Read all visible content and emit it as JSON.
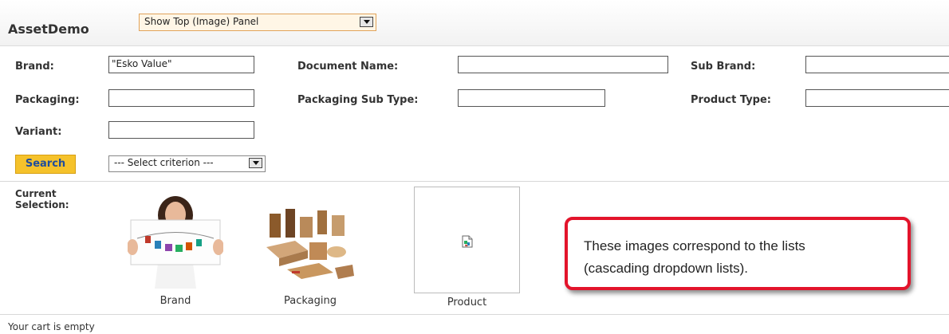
{
  "header": {
    "app_title": "AssetDemo",
    "panel_select_value": "Show Top (Image) Panel"
  },
  "filters": {
    "brand": {
      "label": "Brand:",
      "value": "\"Esko Value\""
    },
    "document_name": {
      "label": "Document Name:",
      "value": ""
    },
    "sub_brand": {
      "label": "Sub Brand:",
      "value": ""
    },
    "packaging": {
      "label": "Packaging:",
      "value": ""
    },
    "packaging_sub_type": {
      "label": "Packaging Sub Type:",
      "value": ""
    },
    "product_type": {
      "label": "Product Type:",
      "value": ""
    },
    "variant": {
      "label": "Variant:",
      "value": ""
    }
  },
  "search": {
    "button_label": "Search",
    "criterion_select_value": "--- Select criterion ---"
  },
  "selection": {
    "heading_line1": "Current",
    "heading_line2": "Selection:",
    "thumbnails": [
      {
        "label": "Brand",
        "icon": "woman-holding-photo-strip"
      },
      {
        "label": "Packaging",
        "icon": "packaging-boxes"
      },
      {
        "label": "Product",
        "icon": "broken-image-icon"
      }
    ]
  },
  "callout": {
    "line1": "These images correspond to the lists",
    "line2": "(cascading dropdown lists)."
  },
  "cart": {
    "status": "Your cart is empty"
  },
  "colors": {
    "accent_button": "#f5c22b",
    "callout_border": "#e3142b",
    "dropdown_border": "#e1a35a"
  }
}
